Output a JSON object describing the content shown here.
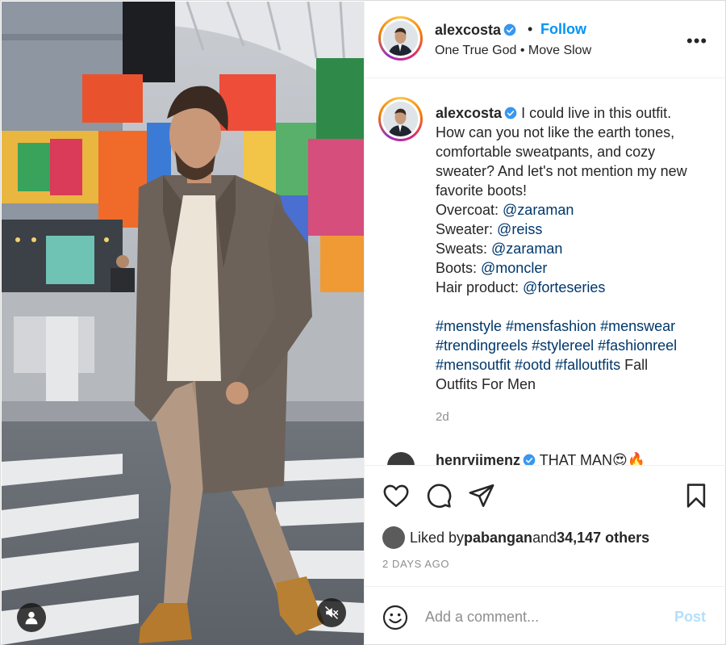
{
  "post": {
    "username": "alexcosta",
    "follow_label": "Follow",
    "dot": "•",
    "subtitle": "One True God • Move Slow",
    "more_label": "•••"
  },
  "caption": {
    "username": "alexcosta",
    "text_lines": [
      "I could live in this outfit.",
      "How can you not like the earth tones,",
      "comfortable sweatpants, and cozy",
      "sweater? And let's not mention my new",
      "favorite boots!"
    ],
    "credits": [
      {
        "label": "Overcoat: ",
        "handle": "@zaraman"
      },
      {
        "label": "Sweater: ",
        "handle": "@reiss"
      },
      {
        "label": "Sweats: ",
        "handle": "@zaraman"
      },
      {
        "label": "Boots: ",
        "handle": "@moncler"
      },
      {
        "label": "Hair product: ",
        "handle": "@forteseries"
      }
    ],
    "hashtags_line1": "#menstyle #mensfashion #menswear",
    "hashtags_line2": "#trendingreels #stylereel #fashionreel",
    "hashtags_line3": "#mensoutfit #ootd #falloutfits",
    "tail_line3": " Fall",
    "tail_line4": "Outfits For Men",
    "age": "2d"
  },
  "next_comment": {
    "username": "henryjimenz",
    "text": "THAT MAN😍🔥"
  },
  "actions": {
    "like_icon": "heart-icon",
    "comment_icon": "comment-icon",
    "share_icon": "paper-plane-icon",
    "save_icon": "bookmark-icon"
  },
  "likes": {
    "prefix": "Liked by ",
    "user": "pabangan",
    "middle": " and ",
    "count": "34,147 others"
  },
  "timestamp": "2 DAYS AGO",
  "comment_box": {
    "placeholder": "Add a comment...",
    "post_label": "Post"
  },
  "colors": {
    "link_blue": "#0095f6",
    "mention": "#00376b",
    "muted": "#8e8e8e",
    "post_disabled": "#b2dffc"
  }
}
